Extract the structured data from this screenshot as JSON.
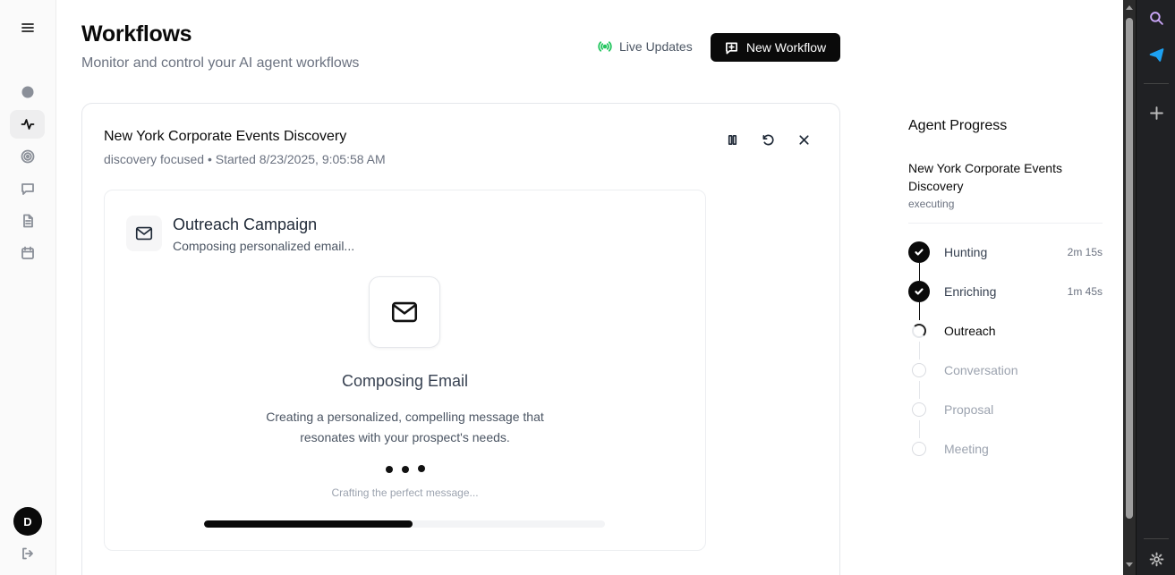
{
  "header": {
    "title": "Workflows",
    "subtitle": "Monitor and control your AI agent workflows",
    "live_updates": "Live Updates",
    "new_workflow": "New Workflow"
  },
  "user": {
    "initial": "D"
  },
  "workflow": {
    "name": "New York Corporate Events Discovery",
    "meta": "discovery focused • Started 8/23/2025, 9:05:58 AM"
  },
  "stage": {
    "title": "Outreach Campaign",
    "status": "Composing personalized email...",
    "compose_title": "Composing Email",
    "compose_desc": "Creating a personalized, compelling message that resonates with your prospect's needs.",
    "hint": "Crafting the perfect message...",
    "progress_percent": 52
  },
  "agent_progress": {
    "title": "Agent Progress",
    "workflow": "New York Corporate Events Discovery",
    "status": "executing",
    "steps": [
      {
        "label": "Hunting",
        "state": "done",
        "duration": "2m 15s"
      },
      {
        "label": "Enriching",
        "state": "done",
        "duration": "1m 45s"
      },
      {
        "label": "Outreach",
        "state": "active",
        "duration": ""
      },
      {
        "label": "Conversation",
        "state": "pending",
        "duration": ""
      },
      {
        "label": "Proposal",
        "state": "pending",
        "duration": ""
      },
      {
        "label": "Meeting",
        "state": "pending",
        "duration": ""
      }
    ]
  },
  "colors": {
    "accent": "#0a0a0a",
    "live": "#22c55e",
    "muted": "#6b7280",
    "pending": "#9ca3af"
  }
}
